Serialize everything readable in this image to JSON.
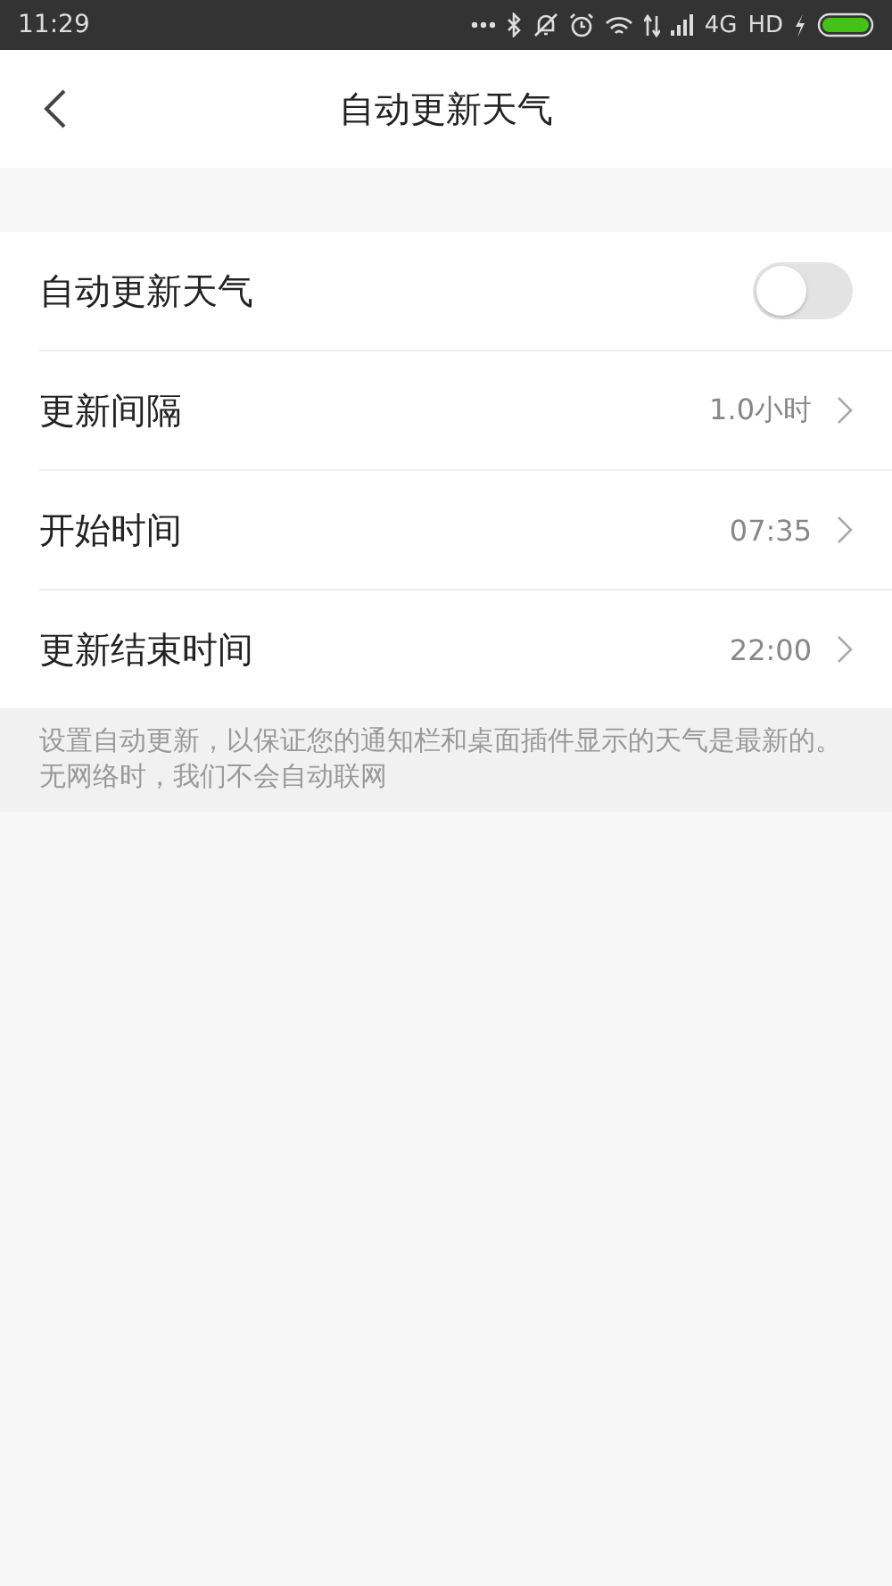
{
  "status_bar": {
    "time": "11:29",
    "network": "4G",
    "hd": "HD"
  },
  "header": {
    "title": "自动更新天气"
  },
  "settings": [
    {
      "kind": "toggle",
      "label": "自动更新天气",
      "on": false
    },
    {
      "kind": "value",
      "label": "更新间隔",
      "value": "1.0小时"
    },
    {
      "kind": "value",
      "label": "开始时间",
      "value": "07:35"
    },
    {
      "kind": "value",
      "label": "更新结束时间",
      "value": "22:00"
    }
  ],
  "notes": [
    "设置自动更新，以保证您的通知栏和桌面插件显示的天气是最新的。",
    "无网络时，我们不会自动联网"
  ]
}
